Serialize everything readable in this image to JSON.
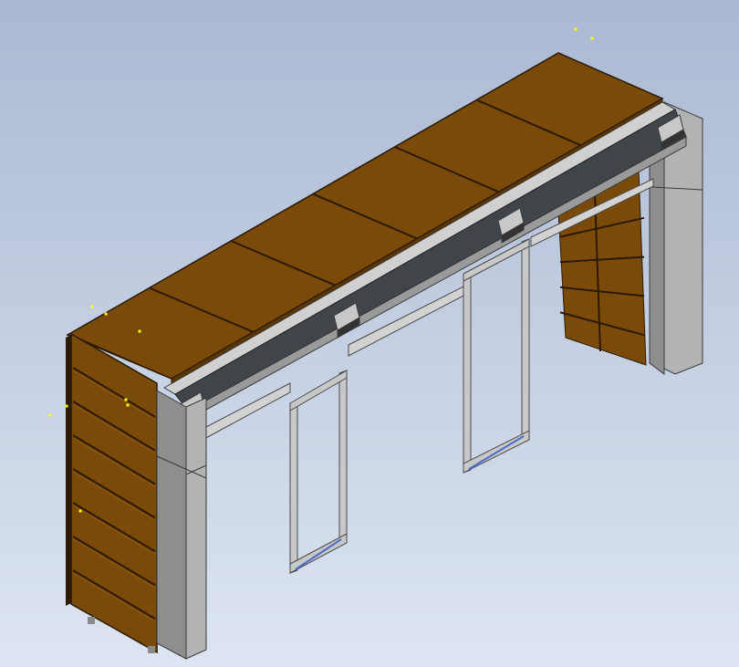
{
  "viewport": {
    "label": "",
    "background_top": "#aab8d2",
    "background_bottom": "#dde5f2"
  },
  "model": {
    "panel_count_top": 6,
    "slab_count_left": 8,
    "slab_count_right": 5,
    "door_leaf_count": 2
  },
  "colors": {
    "wood": "#7a4a08",
    "wood_light": "#8c5a10",
    "wood_dark": "#5a3604",
    "wood_edge": "#2a1a04",
    "column_front": "#b3b3b3",
    "column_side": "#8e8e8e",
    "column_edge": "#3a3a3a",
    "rail_dark": "#3f4548",
    "rail_light": "#c8c8c8",
    "frame": "#c8c8c8",
    "frame_edge": "#4a4a4a",
    "selection_marker": "#ffff00"
  },
  "selection_markers_count": 10
}
